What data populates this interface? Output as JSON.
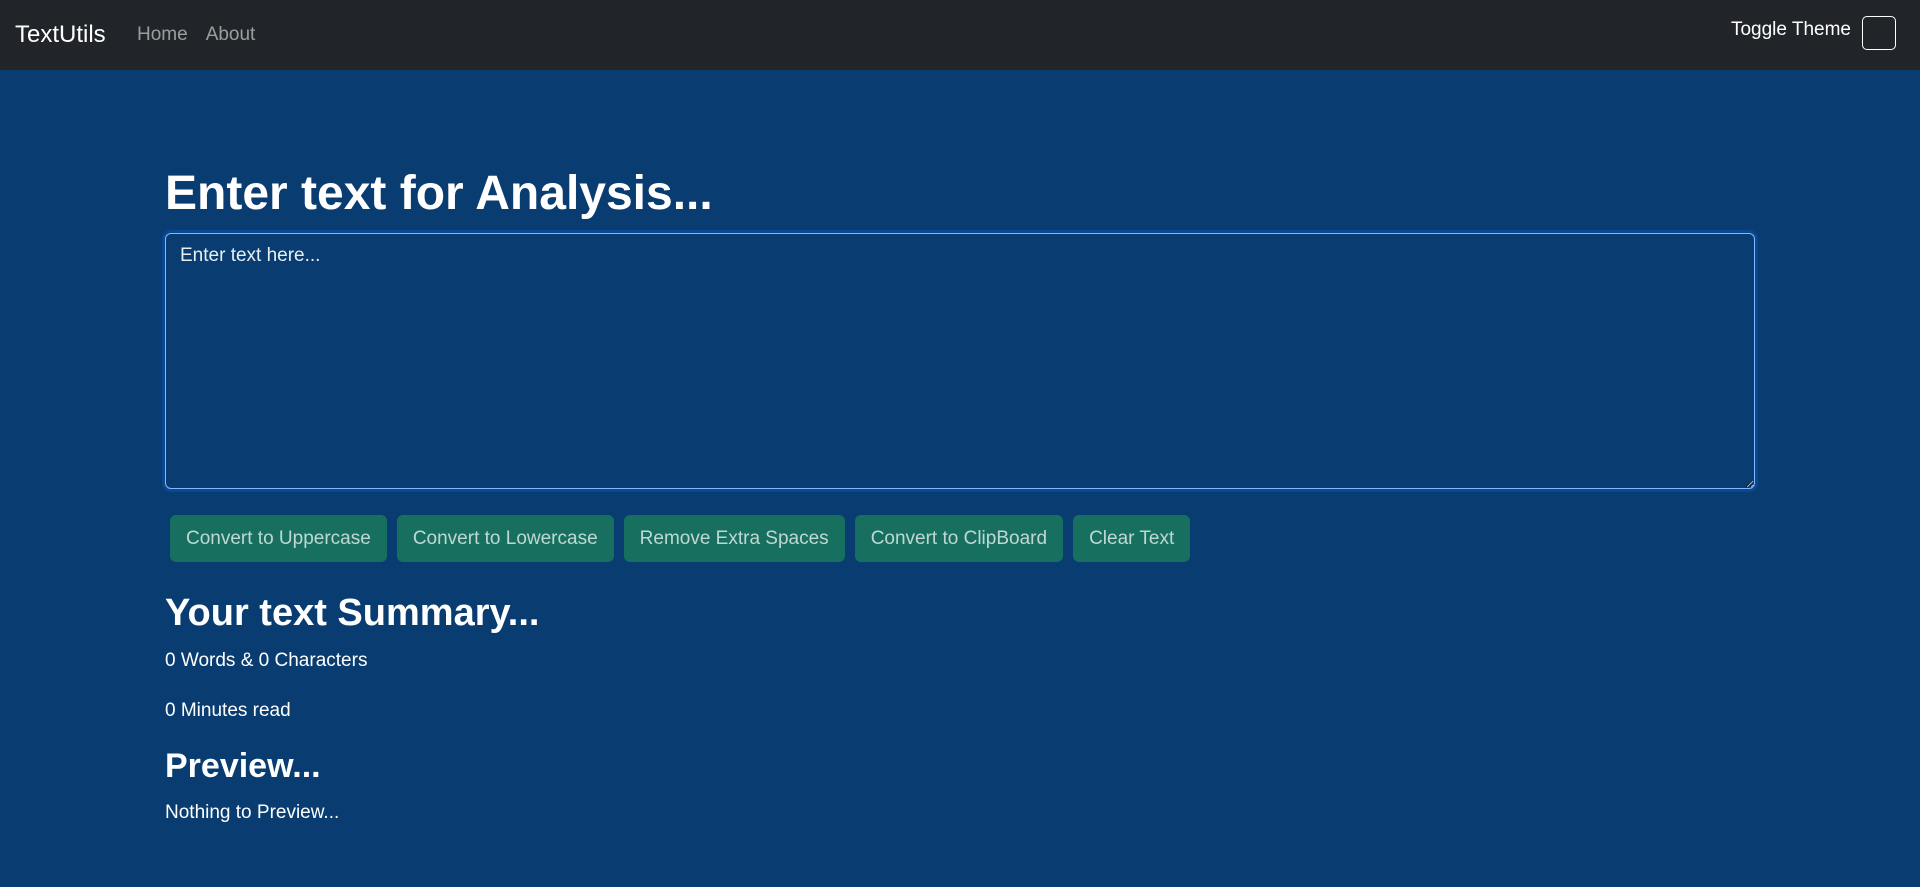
{
  "navbar": {
    "brand": "TextUtils",
    "links": [
      {
        "label": "Home"
      },
      {
        "label": "About"
      }
    ],
    "theme_toggle_label": "Toggle Theme"
  },
  "main": {
    "heading": "Enter text for Analysis...",
    "textarea": {
      "value": "",
      "placeholder": "Enter text here..."
    },
    "buttons": [
      {
        "label": "Convert to Uppercase"
      },
      {
        "label": "Convert to Lowercase"
      },
      {
        "label": "Remove Extra Spaces"
      },
      {
        "label": "Convert to ClipBoard"
      },
      {
        "label": "Clear Text"
      }
    ]
  },
  "summary": {
    "heading": "Your text Summary...",
    "word_count": "0",
    "words_label": "Words &",
    "char_count": "0",
    "chars_label": "Characters",
    "minutes": "0",
    "minutes_label": "Minutes read"
  },
  "preview": {
    "heading": "Preview...",
    "text": "Nothing to Preview..."
  },
  "colors": {
    "page_bg": "#093c70",
    "navbar_bg": "#212529",
    "button_bg": "#17705f",
    "focus_border": "#86b7fe"
  }
}
